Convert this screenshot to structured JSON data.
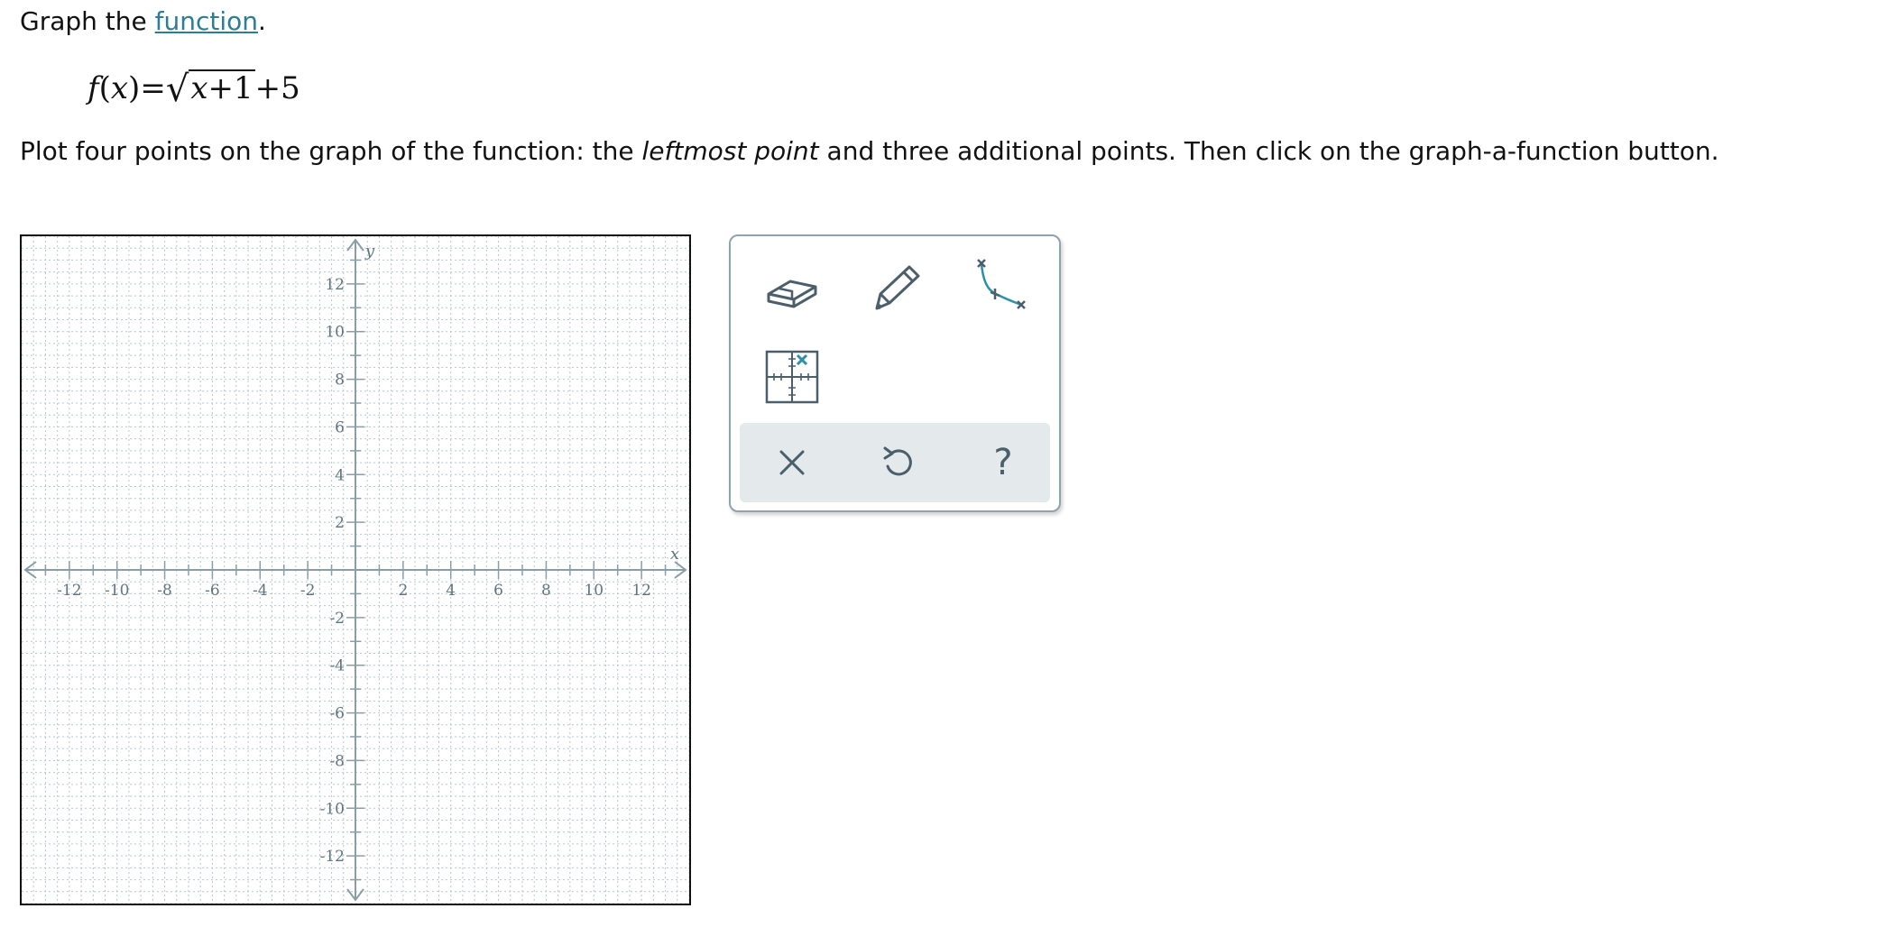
{
  "prompt": {
    "text_before": "Graph the ",
    "link": "function",
    "text_after": "."
  },
  "formula": {
    "lhs_f": "f",
    "lhs_open": "(",
    "lhs_x": "x",
    "lhs_close": ")",
    "equals": "=",
    "rad_x": "x",
    "rad_rest": "+1",
    "tail": "+5"
  },
  "instruction": {
    "part1": "Plot four points on the graph of the function: the ",
    "emphasis": "leftmost point",
    "part2": " and three additional points. Then click on the graph-a-function button."
  },
  "graph": {
    "x_axis_label": "x",
    "y_axis_label": "y",
    "range": [
      -14,
      14
    ],
    "x_tick_labels": [
      "-12",
      "-10",
      "-8",
      "-6",
      "-4",
      "-2",
      "2",
      "4",
      "6",
      "8",
      "10",
      "12"
    ],
    "y_tick_labels_pos": [
      "12",
      "10",
      "8",
      "6",
      "4",
      "2"
    ],
    "y_tick_labels_neg": [
      "-2",
      "-4",
      "-6",
      "-8",
      "-10",
      "-12"
    ],
    "grid_color": "#b7c6cd",
    "axis_color": "#8a9ea8"
  },
  "tools": {
    "eraser_icon": "eraser-icon",
    "pencil_icon": "pencil-icon",
    "graph_function_icon": "graph-function-icon",
    "point_grid_icon": "point-grid-icon",
    "clear_icon": "close-icon",
    "undo_icon": "undo-icon",
    "help_icon": "help-icon",
    "help_glyph": "?",
    "accent_color": "#2e8fa8",
    "icon_color": "#4b5f6b"
  }
}
